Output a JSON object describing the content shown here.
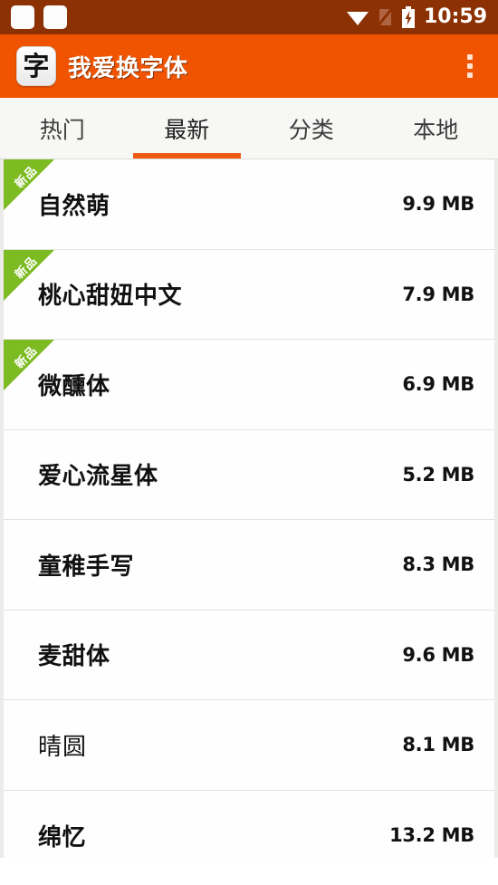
{
  "status_bar": {
    "time": "10:59",
    "icons": [
      "notification-square",
      "notification-square",
      "wifi-icon",
      "no-sim-icon",
      "battery-charging-icon"
    ],
    "background_color": "#8c3103"
  },
  "app_bar": {
    "icon_glyph": "字",
    "title": "我爱换字体",
    "overflow_label": "⋮",
    "background_color": "#f05400"
  },
  "tabs": {
    "active_index": 1,
    "indicator_color": "#ef5a12",
    "items": [
      {
        "label": "热门"
      },
      {
        "label": "最新"
      },
      {
        "label": "分类"
      },
      {
        "label": "本地"
      }
    ]
  },
  "list": {
    "badge_label": "新品",
    "badge_color": "#7cbb21",
    "rows": [
      {
        "name": "自然萌",
        "size": "9.9 MB",
        "is_new": true,
        "style": "bold"
      },
      {
        "name": "桃心甜妞中文",
        "size": "7.9 MB",
        "is_new": true,
        "style": "bold"
      },
      {
        "name": "微醺体",
        "size": "6.9 MB",
        "is_new": true,
        "style": "bold"
      },
      {
        "name": "爱心流星体",
        "size": "5.2 MB",
        "is_new": false,
        "style": "bold"
      },
      {
        "name": "童稚手写",
        "size": "8.3 MB",
        "is_new": false,
        "style": "bold"
      },
      {
        "name": "麦甜体",
        "size": "9.6 MB",
        "is_new": false,
        "style": "bold"
      },
      {
        "name": "晴圆",
        "size": "8.1 MB",
        "is_new": false,
        "style": "light"
      },
      {
        "name": "绵忆",
        "size": "13.2 MB",
        "is_new": false,
        "style": "bold"
      }
    ]
  }
}
